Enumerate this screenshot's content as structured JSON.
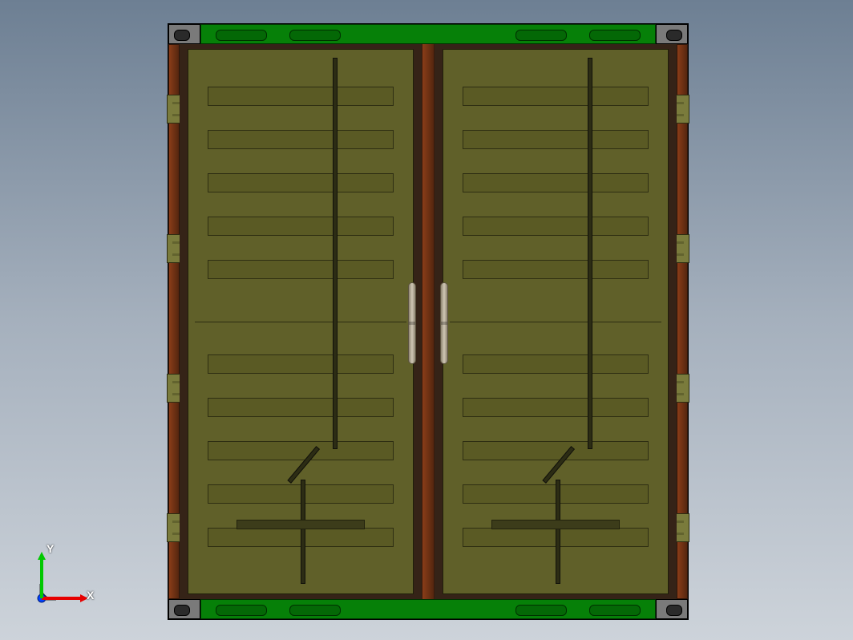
{
  "triad": {
    "x_label": "X",
    "y_label": "Y",
    "x_color": "#e60000",
    "y_color": "#00c800",
    "z_color": "#0040ff",
    "origin_color": "#808080"
  },
  "model": {
    "frame_color": "#068008",
    "door_color": "#606029",
    "post_color": "#8a3d18",
    "hinge_color": "#7a7b3c",
    "ribs_per_half": 5,
    "hinges_per_side": 4
  }
}
